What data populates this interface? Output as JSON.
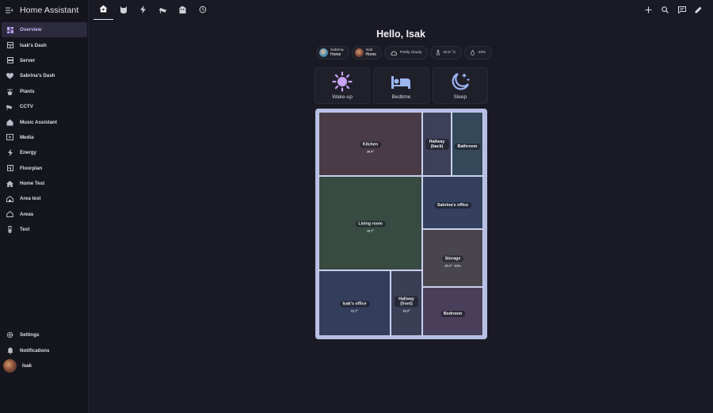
{
  "app": {
    "title": "Home Assistant"
  },
  "sidebar": {
    "items": [
      {
        "label": "Overview",
        "icon": "dashboard-icon",
        "active": true
      },
      {
        "label": "Isak's Dash",
        "icon": "dashboard-grid-icon"
      },
      {
        "label": "Server",
        "icon": "server-icon"
      },
      {
        "label": "Sabrina's Dash",
        "icon": "heart-icon"
      },
      {
        "label": "Plants",
        "icon": "plant-icon"
      },
      {
        "label": "CCTV",
        "icon": "cctv-icon"
      },
      {
        "label": "Music Assistant",
        "icon": "music-home-icon"
      },
      {
        "label": "Media",
        "icon": "media-icon"
      },
      {
        "label": "Energy",
        "icon": "lightning-icon"
      },
      {
        "label": "Floorplan",
        "icon": "floorplan-icon"
      },
      {
        "label": "Home Test",
        "icon": "home-icon"
      },
      {
        "label": "Area test",
        "icon": "area-home-icon"
      },
      {
        "label": "Areas",
        "icon": "home-outline-icon"
      },
      {
        "label": "Test",
        "icon": "test-tube-icon"
      }
    ],
    "settings": "Settings",
    "notifications": "Notifications",
    "user": "Isak"
  },
  "topbar": {
    "tabs": [
      "home-icon",
      "cat-icon",
      "lightning-icon",
      "cctv-icon",
      "building-icon",
      "history-icon"
    ],
    "actions": [
      "add-icon",
      "search-icon",
      "assist-icon",
      "edit-icon"
    ]
  },
  "main": {
    "greeting": "Hello, Isak",
    "badges": {
      "sabrina": {
        "name": "Sabrina",
        "state": "Home"
      },
      "isak": {
        "name": "Isak",
        "state": "Home"
      },
      "weather": "Partly cloudy",
      "temperature": "22.6 °C",
      "humidity": "43%"
    },
    "scenes": [
      {
        "label": "Wake-up",
        "icon": "sun-icon"
      },
      {
        "label": "Bedtime",
        "icon": "bed-icon"
      },
      {
        "label": "Sleep",
        "icon": "moon-stars-icon"
      }
    ],
    "floorplan": {
      "kitchen": {
        "name": "Kitchen",
        "value": "20.4°"
      },
      "hallway_back": {
        "name": "Hallway (back)"
      },
      "bathroom": {
        "name": "Bathroom"
      },
      "living_room": {
        "name": "Living room",
        "value": "19.7°"
      },
      "sabrinas_office": {
        "name": "Sabrina's office"
      },
      "storage": {
        "name": "Storage",
        "value": "20.1° · 61%"
      },
      "isaks_office": {
        "name": "Isak's office",
        "value": "21.7°"
      },
      "hallway_front": {
        "name": "Hallway (front)",
        "value": "20.3°"
      },
      "bedroom": {
        "name": "Bedroom"
      }
    }
  },
  "colors": {
    "background": "#1a1a24",
    "sidebar": "#15151d",
    "accent": "#b9a3ee",
    "floorplan_frame": "#b6bee4",
    "scene_icon": "#9bb6f2",
    "wake_icon": "#c7a3f7"
  }
}
